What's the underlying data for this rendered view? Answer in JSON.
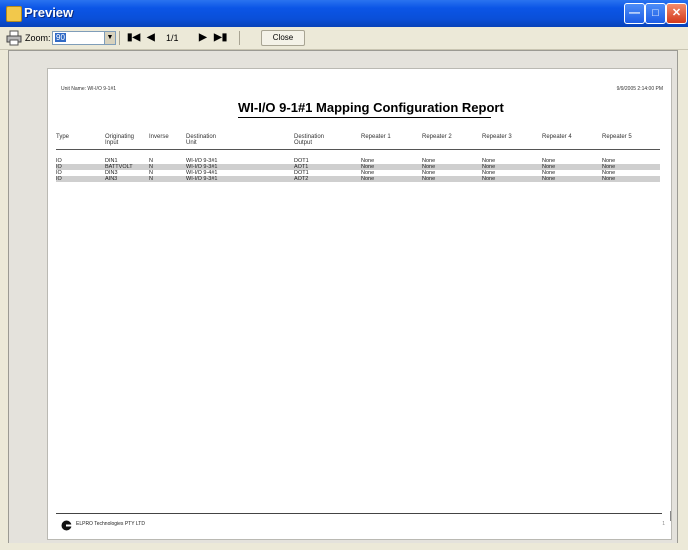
{
  "window": {
    "title": "Preview"
  },
  "toolbar": {
    "zoom_label": "Zoom:",
    "zoom_value": "90",
    "page_indicator": "1/1",
    "close_label": "Close"
  },
  "report": {
    "unit_name": "Unit Name: WI-I/O 9-1#1",
    "date_stamp": "9/9/2005 2:14:00 PM",
    "title": "WI-I/O 9-1#1 Mapping Configuration Report",
    "columns": [
      "Type",
      "Originating Input",
      "Inverse",
      "Destination Unit",
      "Destination Output",
      "Repeater 1",
      "Repeater 2",
      "Repeater 3",
      "Repeater 4",
      "Repeater 5"
    ],
    "rows": [
      [
        "IO",
        "DIN1",
        "N",
        "WI-I/O 9-3#1",
        "DOT1",
        "None",
        "None",
        "None",
        "None",
        "None"
      ],
      [
        "IO",
        "BATTVOLT",
        "N",
        "WI-I/O 9-3#1",
        "AOT1",
        "None",
        "None",
        "None",
        "None",
        "None"
      ],
      [
        "IO",
        "DIN3",
        "N",
        "WI-I/O 9-4#1",
        "DOT1",
        "None",
        "None",
        "None",
        "None",
        "None"
      ],
      [
        "IO",
        "AIN3",
        "N",
        "WI-I/O 9-3#1",
        "AOT2",
        "None",
        "None",
        "None",
        "None",
        "None"
      ]
    ],
    "footer_company": "ELPRO Technologies PTY LTD",
    "footer_page": "1"
  },
  "icons": [
    "preview-window-icon",
    "printer-icon",
    "first-page-icon",
    "prev-page-icon",
    "next-page-icon",
    "last-page-icon",
    "elpro-logo"
  ],
  "colors": {
    "titlebar": "#0b55e6",
    "close_button": "#d43a1c",
    "shaded_row": "#cfcfcf"
  }
}
